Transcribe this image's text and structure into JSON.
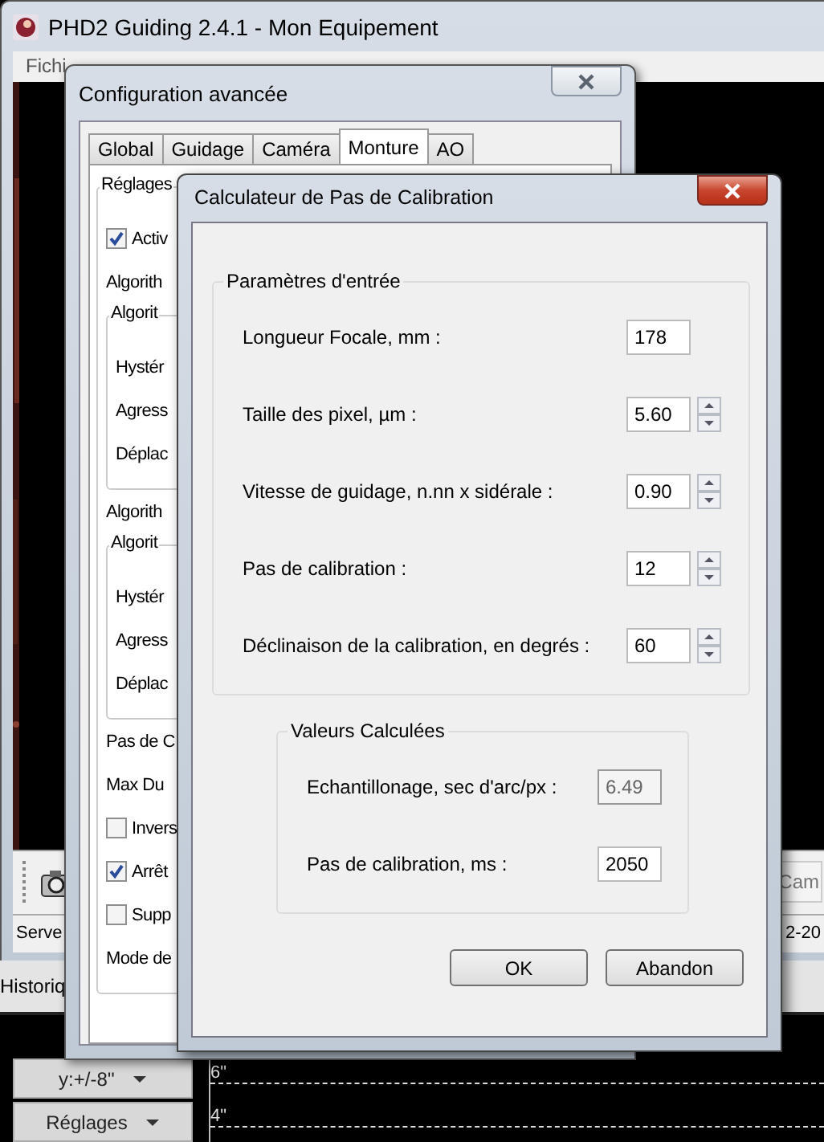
{
  "main_window": {
    "title": "PHD2 Guiding 2.4.1 - Mon Equipement",
    "menu": [
      "Fichi"
    ],
    "toolbar_button": "Cam",
    "status_left": "Serve",
    "status_right": "2-20"
  },
  "graph_panel": {
    "tab": "Historiq",
    "buttons": [
      "y:+/-8''",
      "Réglages"
    ],
    "y_labels": [
      "6\"",
      "4\""
    ]
  },
  "config_dialog": {
    "title": "Configuration avancée",
    "tabs": [
      {
        "label": "Global",
        "selected": false
      },
      {
        "label": "Guidage",
        "selected": false
      },
      {
        "label": "Caméra",
        "selected": false
      },
      {
        "label": "Monture",
        "selected": true
      },
      {
        "label": "AO",
        "selected": false
      }
    ],
    "items": [
      {
        "kind": "group",
        "label": "Réglages",
        "children": [
          {
            "kind": "checkbox",
            "label": "Activ",
            "checked": true
          },
          {
            "kind": "label",
            "label": "Algorith"
          },
          {
            "kind": "group",
            "label": "Algorit",
            "children": [
              {
                "kind": "label",
                "label": "Hystér"
              },
              {
                "kind": "label",
                "label": "Agress"
              },
              {
                "kind": "label",
                "label": "Déplac"
              }
            ]
          },
          {
            "kind": "label",
            "label": "Algorith"
          },
          {
            "kind": "group",
            "label": "Algorit",
            "children": [
              {
                "kind": "label",
                "label": "Hystér"
              },
              {
                "kind": "label",
                "label": "Agress"
              },
              {
                "kind": "label",
                "label": "Déplac"
              }
            ]
          },
          {
            "kind": "label",
            "label": "Pas de C"
          },
          {
            "kind": "label",
            "label": "Max Du"
          },
          {
            "kind": "checkbox",
            "label": "Invers",
            "checked": false
          },
          {
            "kind": "checkbox",
            "label": "Arrêt",
            "checked": true
          },
          {
            "kind": "checkbox",
            "label": "Supp",
            "checked": false
          },
          {
            "kind": "label",
            "label": "Mode de"
          }
        ]
      }
    ]
  },
  "calc_dialog": {
    "title": "Calculateur de Pas de Calibration",
    "input_group": {
      "title": "Paramètres d'entrée",
      "fields": [
        {
          "label": "Longueur Focale, mm :",
          "value": "178",
          "spinner": false
        },
        {
          "label": "Taille des pixel, µm :",
          "value": "5.60",
          "spinner": true
        },
        {
          "label": "Vitesse de guidage, n.nn x sidérale :",
          "value": "0.90",
          "spinner": true
        },
        {
          "label": "Pas de calibration :",
          "value": "12",
          "spinner": true
        },
        {
          "label": "Déclinaison de la calibration, en degrés :",
          "value": "60",
          "spinner": true
        }
      ]
    },
    "output_group": {
      "title": "Valeurs Calculées",
      "fields": [
        {
          "label": "Echantillonage, sec d'arc/px :",
          "value": "6.49",
          "disabled": true
        },
        {
          "label": "Pas de calibration, ms :",
          "value": "2050",
          "disabled": false
        }
      ]
    },
    "buttons": [
      "OK",
      "Abandon"
    ]
  }
}
